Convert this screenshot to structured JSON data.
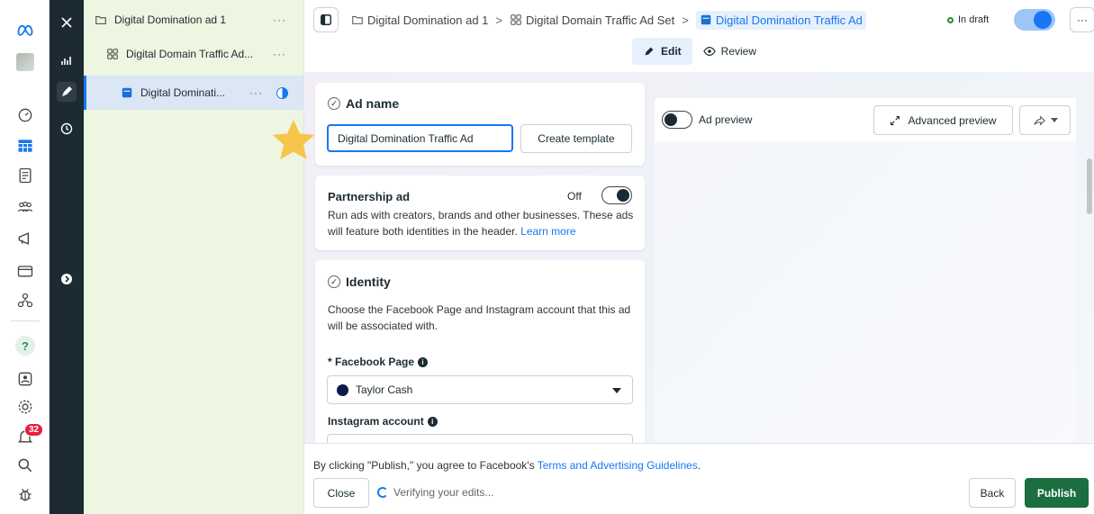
{
  "nav": {
    "badge_count": "32",
    "icons": [
      "meta-logo-icon",
      "account-avatar-icon",
      "dashboard-icon",
      "campaigns-table-icon",
      "pages-icon",
      "audiences-icon",
      "advertise-icon",
      "billing-icon",
      "business-settings-icon",
      "help-icon",
      "contact-icon",
      "settings-icon",
      "notifications-icon",
      "search-icon",
      "bug-report-icon"
    ]
  },
  "tree": {
    "items": [
      {
        "label": "Digital Domination ad 1",
        "more": "···"
      },
      {
        "label": "Digital Domain Traffic Ad...",
        "more": "···"
      },
      {
        "label": "Digital Dominati...",
        "more": "···"
      }
    ]
  },
  "breadcrumb": {
    "campaign": "Digital Domination ad 1",
    "adset": "Digital Domain Traffic Ad Set",
    "ad": "Digital Domination Traffic Ad",
    "sep": ">"
  },
  "status": {
    "label": "In draft"
  },
  "more_label": "···",
  "tabs": {
    "edit": "Edit",
    "review": "Review"
  },
  "ad_name": {
    "title": "Ad name",
    "value": "Digital Domination Traffic Ad",
    "create_template": "Create template"
  },
  "partnership": {
    "title": "Partnership ad",
    "toggle_label": "Off",
    "description": "Run ads with creators, brands and other businesses. These ads will feature both identities in the header.",
    "learn_more": "Learn more"
  },
  "identity": {
    "title": "Identity",
    "description": "Choose the Facebook Page and Instagram account that this ad will be associated with.",
    "facebook_label": "* Facebook Page",
    "facebook_value": "Taylor Cash",
    "instagram_label": "Instagram account"
  },
  "preview": {
    "toggle_label": "Ad preview",
    "advanced_label": "Advanced preview"
  },
  "footer": {
    "terms_prefix": "By clicking \"Publish,\" you agree to Facebook's",
    "terms_link": "Terms and Advertising Guidelines",
    "terms_suffix": ".",
    "close": "Close",
    "verifying": "Verifying your edits...",
    "back": "Back",
    "publish": "Publish"
  },
  "colors": {
    "accent": "#1877f2",
    "publish": "#1b6e3f",
    "badge": "#e41e3f",
    "star": "#f7c54a"
  }
}
